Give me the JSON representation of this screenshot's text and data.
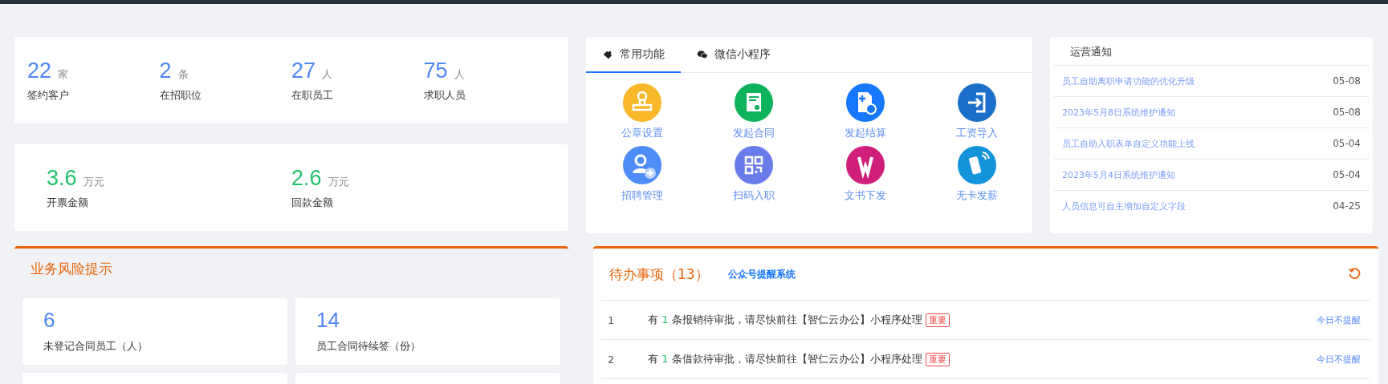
{
  "stats": [
    {
      "value": "22",
      "unit": "家",
      "label": "签约客户"
    },
    {
      "value": "2",
      "unit": "条",
      "label": "在招职位"
    },
    {
      "value": "27",
      "unit": "人",
      "label": "在职员工"
    },
    {
      "value": "75",
      "unit": "人",
      "label": "求职人员"
    }
  ],
  "amounts": [
    {
      "value": "3.6",
      "unit": "万元",
      "label": "开票金额"
    },
    {
      "value": "2.6",
      "unit": "万元",
      "label": "回款金额"
    }
  ],
  "functions": {
    "tabs": [
      {
        "label": "常用功能",
        "selected": true
      },
      {
        "label": "微信小程序",
        "selected": false
      }
    ],
    "items": [
      {
        "label": "公章设置",
        "color": "#f8b82a"
      },
      {
        "label": "发起合同",
        "color": "#0db35c"
      },
      {
        "label": "发起结算",
        "color": "#1677ff"
      },
      {
        "label": "工资导入",
        "color": "#1b6fc9"
      },
      {
        "label": "招聘管理",
        "color": "#4e8cf7"
      },
      {
        "label": "扫码入职",
        "color": "#6a7bea"
      },
      {
        "label": "文书下发",
        "color": "#cf1f7a"
      },
      {
        "label": "无卡发薪",
        "color": "#1393d9"
      }
    ]
  },
  "notices": {
    "title": "运营通知",
    "items": [
      {
        "text": "员工自助离职申请功能的优化升级",
        "date": "05-08"
      },
      {
        "text": "2023年5月8日系统维护通知",
        "date": "05-08"
      },
      {
        "text": "员工自助入职表单自定义功能上线",
        "date": "05-04"
      },
      {
        "text": "2023年5月4日系统维护通知",
        "date": "05-04"
      },
      {
        "text": "人员信息可自主增加自定义字段",
        "date": "04-25"
      }
    ]
  },
  "risk": {
    "title": "业务风险提示",
    "tiles": [
      {
        "value": "6",
        "label": "未登记合同员工（人）"
      },
      {
        "value": "14",
        "label": "员工合同待续签（份）"
      }
    ]
  },
  "todo": {
    "title": "待办事项（13）",
    "link": "公众号提醒系统",
    "rows": [
      {
        "index": "1",
        "prefix": "有",
        "count": "1",
        "text": "条报销待审批，请尽快前往【智仁云办公】小程序处理",
        "tag": "重要",
        "action": "今日不提醒"
      },
      {
        "index": "2",
        "prefix": "有",
        "count": "1",
        "text": "条借款待审批，请尽快前往【智仁云办公】小程序处理",
        "tag": "重要",
        "action": "今日不提醒"
      }
    ]
  }
}
